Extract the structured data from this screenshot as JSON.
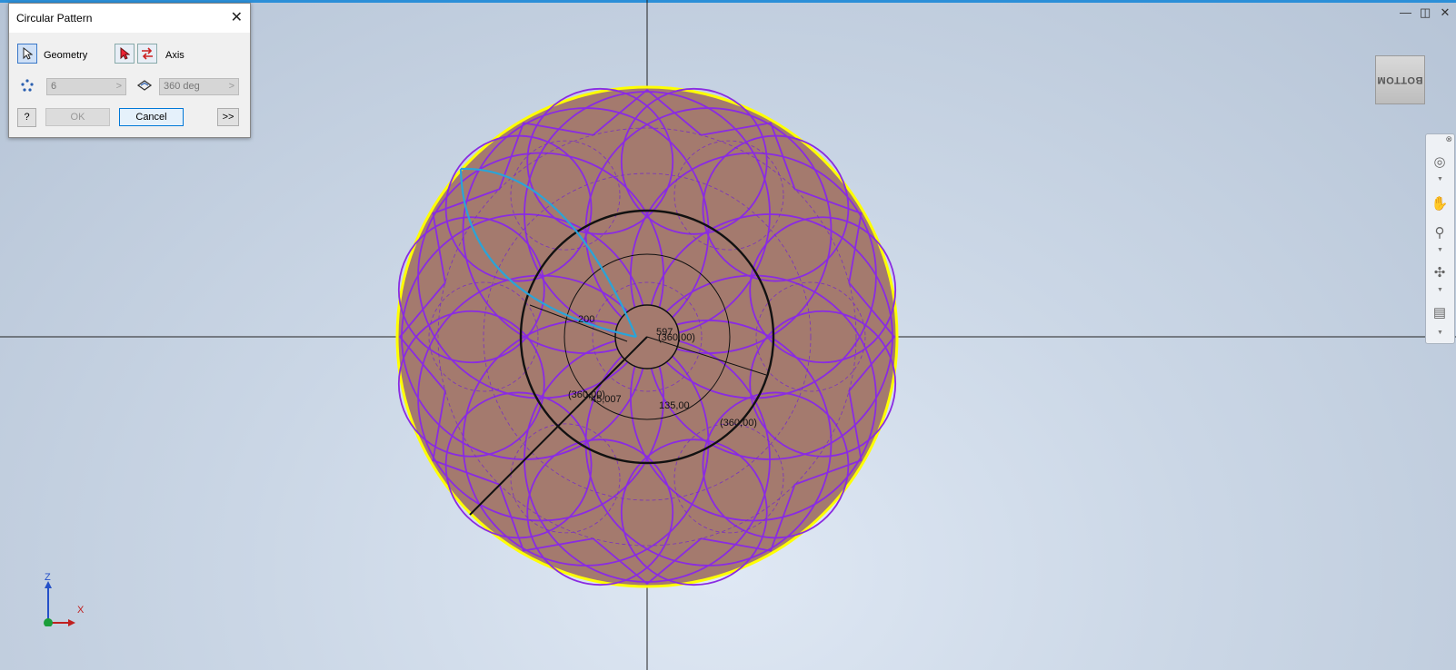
{
  "dialog": {
    "title": "Circular Pattern",
    "geometry_label": "Geometry",
    "axis_label": "Axis",
    "count_value": "6",
    "count_arrow": ">",
    "angle_value": "360 deg",
    "angle_arrow": ">",
    "ok_label": "OK",
    "cancel_label": "Cancel",
    "more_label": ">>",
    "help_label": "?"
  },
  "viewcube": {
    "face_label": "BOTTOM"
  },
  "triad": {
    "z_label": "Z",
    "x_label": "X"
  },
  "sketch": {
    "dim_200": "200",
    "dim_597": "597",
    "dim_360_center": "(360,00)",
    "dim_360_left": "(360,00)",
    "dim_45": "45,007",
    "dim_135": "135,00",
    "dim_360_right": "(360,00)"
  },
  "colors": {
    "disk_fill": "#a47a6e",
    "disk_edge": "#ffff00",
    "pattern_stroke": "#8a2be2",
    "highlight_arc": "#2aa4d8",
    "accent": "#0078d7"
  },
  "icons": {
    "close": "close-icon",
    "geometry_select": "cursor-arrow-icon",
    "axis_select": "cursor-arrow-red-icon",
    "flip": "flip-direction-icon",
    "count": "pattern-count-icon",
    "angle": "angle-icon",
    "help": "help-icon"
  }
}
